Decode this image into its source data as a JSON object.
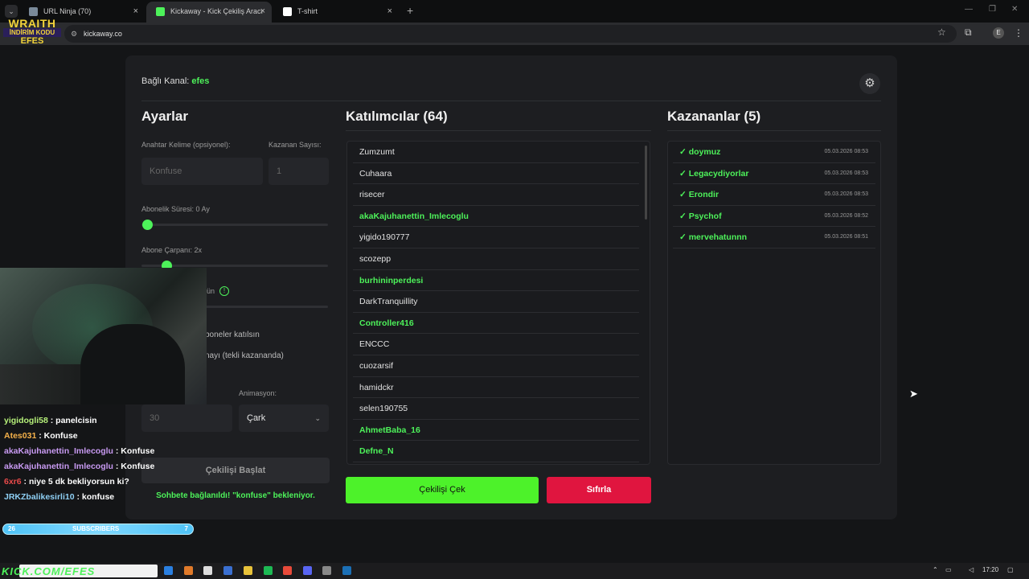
{
  "browser": {
    "tabs": [
      {
        "title": "URL Ninja (70)",
        "active": false
      },
      {
        "title": "Kickaway - Kick Çekiliş Aracı",
        "active": true
      },
      {
        "title": "T-shirt",
        "active": false
      }
    ],
    "url": "kickaway.co"
  },
  "brand": {
    "line1": "WRAITH",
    "line2": "İNDİRİM KODU",
    "line3": "EFES"
  },
  "header": {
    "connected_label": "Bağlı Kanal:",
    "channel": "efes"
  },
  "settings": {
    "title": "Ayarlar",
    "keyword_label": "Anahtar Kelime (opsiyonel):",
    "keyword_placeholder": "Konfuse",
    "winner_count_label": "Kazanan Sayısı:",
    "winner_count_placeholder": "1",
    "sub_duration_label": "Abonelik Süresi: 0 Ay",
    "sub_duration_value": 0,
    "sub_multiplier_label": "Abone Çarpanı: 2x",
    "sub_multiplier_value": 2,
    "partial_label_1": "ün",
    "partial_label_2": "boneler katılsın",
    "partial_label_3": "nayı (tekli kazananda)",
    "animation_label": "Animasyon:",
    "duration_placeholder": "30",
    "animation_value": "Çark",
    "start_button": "Çekilişi Başlat",
    "status": "Sohbete bağlanıldı! \"konfuse\" bekleniyor."
  },
  "participants": {
    "title": "Katılımcılar (64)",
    "items": [
      {
        "name": "Zumzumt",
        "sub": false
      },
      {
        "name": "Cuhaara",
        "sub": false
      },
      {
        "name": "risecer",
        "sub": false
      },
      {
        "name": "akaKajuhanettin_Imlecoglu",
        "sub": true
      },
      {
        "name": "yigido190777",
        "sub": false
      },
      {
        "name": "scozepp",
        "sub": false
      },
      {
        "name": "burhininperdesi",
        "sub": true
      },
      {
        "name": "DarkTranquillity",
        "sub": false
      },
      {
        "name": "Controller416",
        "sub": true
      },
      {
        "name": "ENCCC",
        "sub": false
      },
      {
        "name": "cuozarsif",
        "sub": false
      },
      {
        "name": "hamidckr",
        "sub": false
      },
      {
        "name": "selen190755",
        "sub": false
      },
      {
        "name": "AhmetBaba_16",
        "sub": true
      },
      {
        "name": "Defne_N",
        "sub": true
      }
    ],
    "draw_button": "Çekilişi Çek",
    "reset_button": "Sıfırla"
  },
  "winners": {
    "title": "Kazananlar (5)",
    "items": [
      {
        "name": "✓ doymuz",
        "date": "05.03.2026 08:53"
      },
      {
        "name": "✓ Legacydiyorlar",
        "date": "05.03.2026 08:53"
      },
      {
        "name": "✓ Erondir",
        "date": "05.03.2026 08:53"
      },
      {
        "name": "✓ Psychof",
        "date": "05.03.2026 08:52"
      },
      {
        "name": "✓ mervehatunnn",
        "date": "05.03.2026 08:51"
      }
    ]
  },
  "chat": [
    {
      "user": "yigidogli58",
      "msg": ": panelcisin",
      "color": "#b6f07a"
    },
    {
      "user": "Ates031",
      "msg": ": Konfuse",
      "color": "#f5b14a"
    },
    {
      "user": "akaKajuhanettin_Imlecoglu",
      "msg": ": Konfuse",
      "color": "#c89af2"
    },
    {
      "user": "akaKajuhanettin_Imlecoglu",
      "msg": ": Konfuse",
      "color": "#c89af2"
    },
    {
      "user": "6xr6",
      "msg": ": niye 5 dk bekliyorsun ki?",
      "color": "#e84a4a"
    },
    {
      "user": "JRKZbalikesirli10",
      "msg": ": konfuse",
      "color": "#8fd0f5"
    }
  ],
  "subs_bar": {
    "left": "26",
    "label": "SUBSCRIBERS",
    "right": "7"
  },
  "overlay_url": "KICK.COM/EFES",
  "taskbar": {
    "time": "17:20"
  },
  "colors": {
    "accent": "#4df25a",
    "danger": "#e0153f",
    "panel": "#1d1e21"
  }
}
